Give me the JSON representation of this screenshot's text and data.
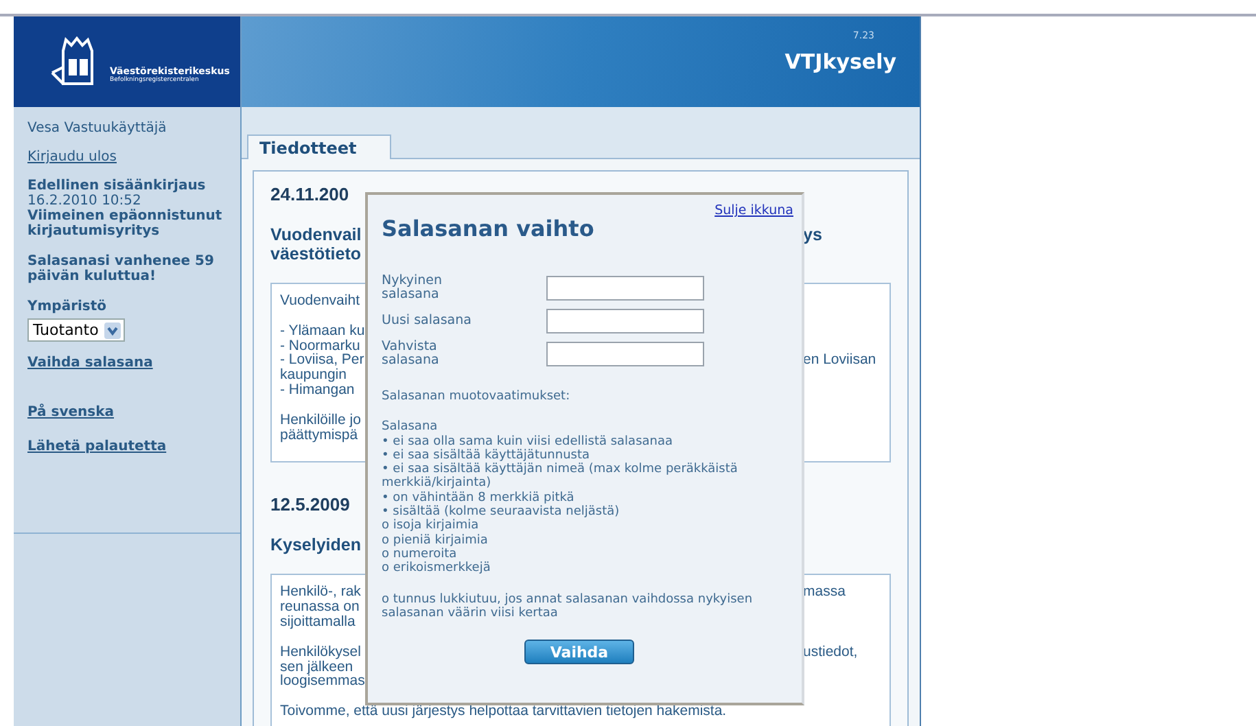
{
  "header": {
    "org_name": "Väestörekisterikeskus",
    "org_name_sv": "Befolkningsregistercentralen",
    "version": "7.23",
    "app_title": "VTJkysely"
  },
  "sidebar": {
    "user": "Vesa Vastuukäyttäjä",
    "logout": "Kirjaudu ulos",
    "last_login_label": "Edellinen sisäänkirjaus",
    "last_login_time": "16.2.2010 10:52",
    "failed_label": "Viimeinen epäonnistunut kirjautumisyritys",
    "expiry_notice": "Salasanasi vanhenee 59 päivän kuluttua!",
    "environment_label": "Ympäristö",
    "environment_value": "Tuotanto",
    "links": [
      {
        "label": "Vaihda salasana"
      },
      {
        "label": "På svenska"
      },
      {
        "label": "Lähetä palautetta"
      }
    ]
  },
  "tabs": [
    {
      "label": "Tiedotteet",
      "selected": true
    }
  ],
  "news": [
    {
      "date": "24.11.200",
      "title_lines": [
        {
          "left": "Vuodenvail",
          "right": "ys"
        },
        {
          "left": "väestötieto"
        }
      ],
      "paragraphs": [
        [
          {
            "left": "Vuodenvaiht"
          }
        ],
        [
          {
            "left": "- Ylämaan ku"
          },
          {
            "left": "- Noormarku"
          },
          {
            "left": "- Loviisa, Per",
            "right": "en Loviisan"
          },
          {
            "left": "kaupungin"
          },
          {
            "left": "- Himangan"
          }
        ],
        [
          {
            "left": "Henkilöille jo"
          },
          {
            "left": "päättymispä"
          }
        ]
      ]
    },
    {
      "date": "12.5.2009",
      "title_lines": [
        {
          "left": "Kyselyiden"
        }
      ],
      "paragraphs": [
        [
          {
            "left": "Henkilö-, rak",
            "right": "massa"
          },
          {
            "left": "reunassa on"
          },
          {
            "left": "sijoittamalla"
          }
        ],
        [
          {
            "left": "Henkilökysel",
            "right": "ustiedot,"
          },
          {
            "left": "sen jälkeen"
          },
          {
            "left": "loogisemmas"
          }
        ],
        [
          {
            "left": "Toivomme, että uusi järjestys helpottaa tarvittavien tietojen hakemista."
          }
        ]
      ]
    }
  ],
  "dialog": {
    "close_link": "Sulje ikkuna",
    "title": "Salasanan vaihto",
    "fields": [
      {
        "label": "Nykyinen salasana"
      },
      {
        "label": "Uusi salasana"
      },
      {
        "label": "Vahvista salasana"
      }
    ],
    "requirements_heading": "Salasanan muotovaatimukset:",
    "requirements": [
      "Salasana",
      "• ei saa olla sama kuin viisi edellistä salasanaa",
      "• ei saa sisältää käyttäjätunnusta",
      "• ei saa sisältää käyttäjän nimeä (max kolme peräkkäistä merkkiä/kirjainta)",
      "• on vähintään 8 merkkiä pitkä",
      "• sisältää (kolme seuraavista neljästä)",
      "o isoja kirjaimia",
      "o pieniä kirjaimia",
      "o numeroita",
      "o erikoismerkkejä"
    ],
    "lock_notice": "o tunnus lukkiutuu, jos annat salasanan vaihdossa nykyisen salasanan väärin viisi kertaa",
    "submit": "Vaihda"
  }
}
